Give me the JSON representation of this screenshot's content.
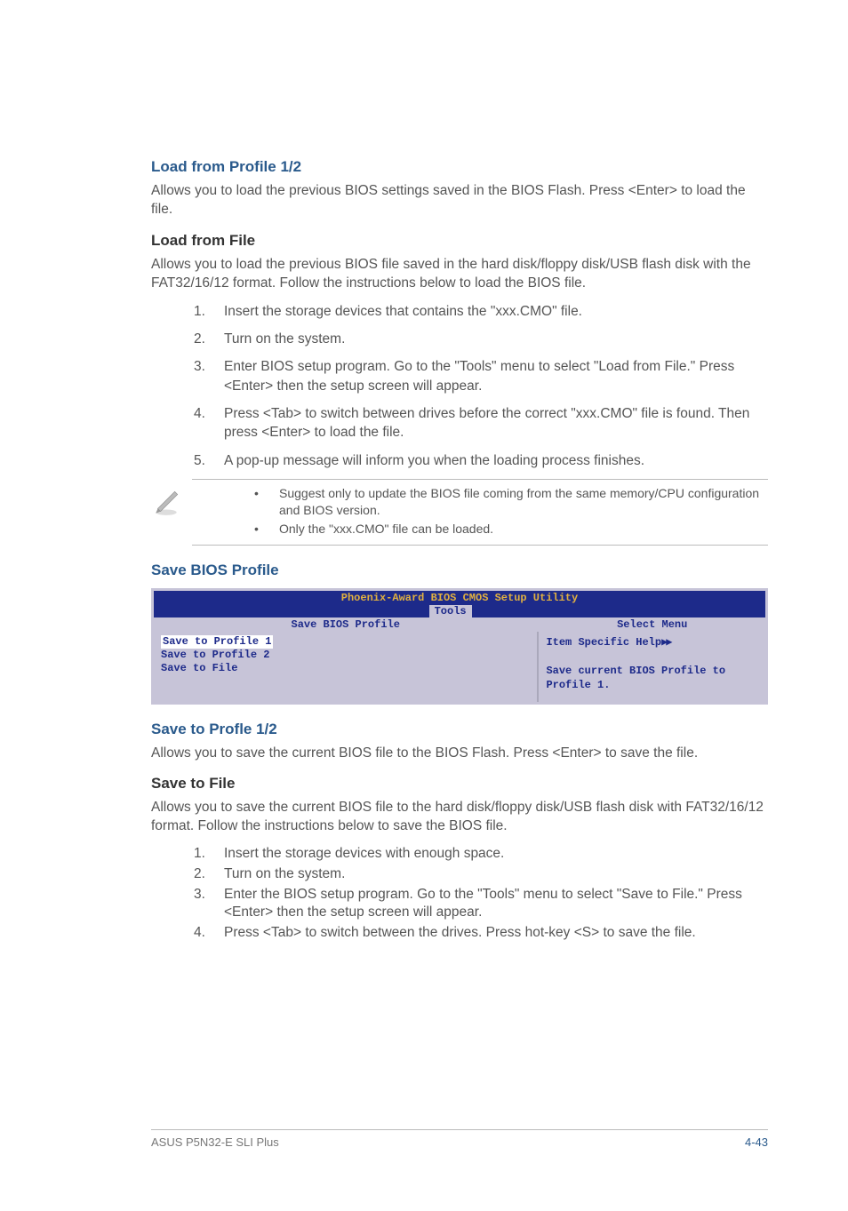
{
  "sections": {
    "load_profile": {
      "heading": "Load from Profile 1/2",
      "body": "Allows you to load the previous BIOS settings saved in the BIOS Flash. Press <Enter> to load the file."
    },
    "load_file": {
      "heading": "Load from File",
      "body": "Allows you to load the previous BIOS file saved in the hard disk/floppy disk/USB flash disk with the FAT32/16/12 format. Follow the instructions below to load the BIOS file.",
      "steps": [
        {
          "n": "1.",
          "t": "Insert the storage devices that contains the \"xxx.CMO\" file."
        },
        {
          "n": "2.",
          "t": "Turn on the system."
        },
        {
          "n": "3.",
          "t": "Enter BIOS setup program. Go to the \"Tools\" menu to select \"Load from File.\" Press <Enter> then the setup screen will appear."
        },
        {
          "n": "4.",
          "t": "Press <Tab> to switch between drives before the correct \"xxx.CMO\" file is found. Then press <Enter> to load the file."
        },
        {
          "n": "5.",
          "t": "A pop-up message will inform you when the loading process finishes."
        }
      ]
    },
    "notes": [
      "Suggest only to update the BIOS file coming from the same memory/CPU configuration and BIOS version.",
      "Only the \"xxx.CMO\" file can be loaded."
    ],
    "save_bios_profile_heading": "Save BIOS Profile",
    "bios": {
      "title": "Phoenix-Award BIOS CMOS Setup Utility",
      "tab": "Tools",
      "panel_title": "Save BIOS Profile",
      "right_title": "Select Menu",
      "left_items": [
        "Save to Profile 1",
        "Save to Profile 2",
        "Save to File"
      ],
      "right_help_label": "Item Specific Help",
      "right_help_body": "Save current BIOS Profile to Profile 1."
    },
    "save_profile": {
      "heading": "Save to Profle 1/2",
      "body": "Allows you to save the current BIOS file to the BIOS Flash. Press <Enter> to save the file."
    },
    "save_file": {
      "heading": "Save to File",
      "body": "Allows you to save the current BIOS file to the hard disk/floppy disk/USB flash disk with FAT32/16/12 format. Follow the instructions below to save the BIOS file.",
      "steps": [
        {
          "n": "1.",
          "t": "Insert the storage devices with enough space."
        },
        {
          "n": "2.",
          "t": "Turn on the system."
        },
        {
          "n": "3.",
          "t": "Enter the BIOS setup program. Go to the \"Tools\" menu to select \"Save to File.\" Press <Enter> then the setup screen will appear."
        },
        {
          "n": "4.",
          "t": "Press <Tab> to switch between the drives. Press hot-key <S> to save the file."
        }
      ]
    }
  },
  "footer": {
    "product": "ASUS P5N32-E SLI Plus",
    "page": "4-43"
  },
  "bullet": "•"
}
